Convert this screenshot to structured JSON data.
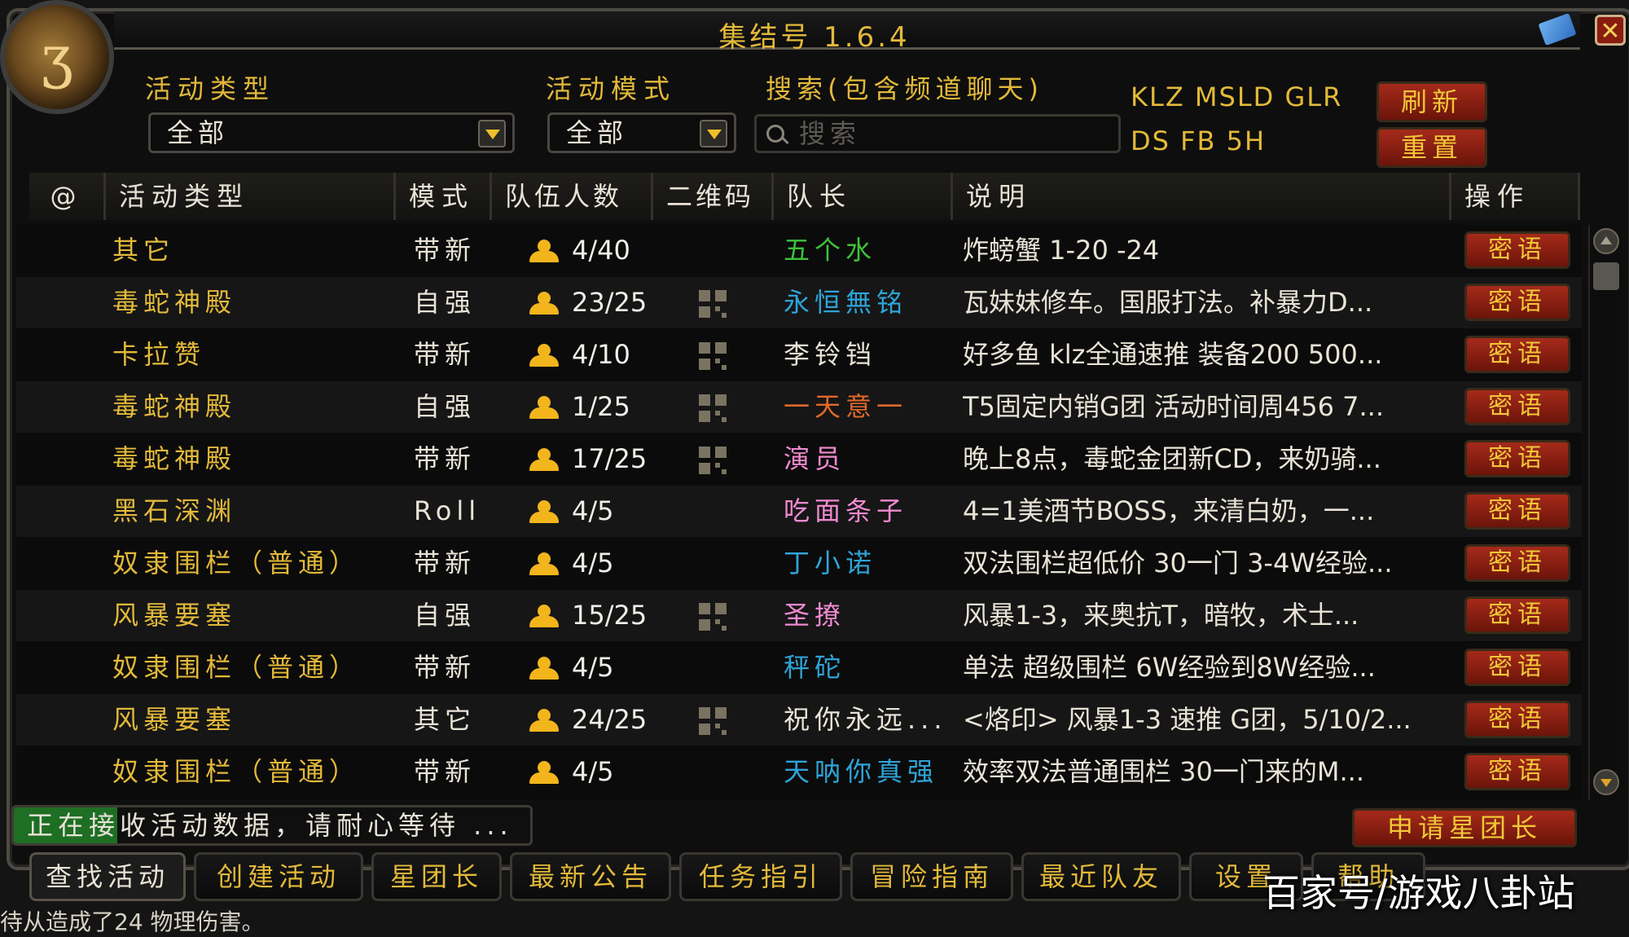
{
  "window": {
    "title": "集结号 1.6.4",
    "logo_glyph": "ʒ"
  },
  "filters": {
    "activity_type_label": "活动类型",
    "activity_type_value": "全部",
    "activity_mode_label": "活动模式",
    "activity_mode_value": "全部",
    "search_label": "搜索(包含频道聊天)",
    "search_placeholder": "搜索"
  },
  "tags": {
    "line1": "KLZ MSLD GLR",
    "line2": "DS FB 5H"
  },
  "buttons": {
    "refresh": "刷新",
    "reset": "重置",
    "whisper": "密语",
    "apply_leader": "申请星团长"
  },
  "columns": [
    "@",
    "活动类型",
    "模式",
    "队伍人数",
    "二维码",
    "队长",
    "说明",
    "操作"
  ],
  "rows": [
    {
      "type": "其它",
      "mode": "带新",
      "count": "4/40",
      "qr": false,
      "leader": "五个水",
      "leader_color": "#3fc23a",
      "desc": "炸螃蟹 1-20 -24"
    },
    {
      "type": "毒蛇神殿",
      "mode": "自强",
      "count": "23/25",
      "qr": true,
      "leader": "永恒無铭",
      "leader_color": "#2fa4d8",
      "desc": "瓦妹妹修车。国服打法。补暴力D..."
    },
    {
      "type": "卡拉赞",
      "mode": "带新",
      "count": "4/10",
      "qr": true,
      "leader": "李铃铛",
      "leader_color": "#e8e3d6",
      "desc": "好多鱼 klz全通速推 装备200 500..."
    },
    {
      "type": "毒蛇神殿",
      "mode": "自强",
      "count": "1/25",
      "qr": true,
      "leader": "一天意一",
      "leader_color": "#e0692a",
      "desc": "T5固定内销G团 活动时间周456 7..."
    },
    {
      "type": "毒蛇神殿",
      "mode": "带新",
      "count": "17/25",
      "qr": true,
      "leader": "演员",
      "leader_color": "#f08ad0",
      "desc": "晚上8点，毒蛇金团新CD，来奶骑..."
    },
    {
      "type": "黑石深渊",
      "mode": "Roll",
      "count": "4/5",
      "qr": false,
      "leader": "吃面条子",
      "leader_color": "#f08ad0",
      "desc": "4=1美酒节BOSS，来清白奶，一..."
    },
    {
      "type": "奴隶围栏（普通）",
      "mode": "带新",
      "count": "4/5",
      "qr": false,
      "leader": "丁小诺",
      "leader_color": "#2fa4d8",
      "desc": "双法围栏超低价 30一门 3-4W经验..."
    },
    {
      "type": "风暴要塞",
      "mode": "自强",
      "count": "15/25",
      "qr": true,
      "leader": "圣撩",
      "leader_color": "#f08ad0",
      "desc": "风暴1-3，来奥抗T，暗牧，术士..."
    },
    {
      "type": "奴隶围栏（普通）",
      "mode": "带新",
      "count": "4/5",
      "qr": false,
      "leader": "秤砣",
      "leader_color": "#2fa4d8",
      "desc": "单法 超级围栏 6W经验到8W经验..."
    },
    {
      "type": "风暴要塞",
      "mode": "其它",
      "count": "24/25",
      "qr": true,
      "leader": "祝你永远...",
      "leader_color": "#e8e3d6",
      "desc": "<烙印> 风暴1-3 速推 G团，5/10/2..."
    },
    {
      "type": "奴隶围栏（普通）",
      "mode": "带新",
      "count": "4/5",
      "qr": false,
      "leader": "天呐你真强",
      "leader_color": "#2fa4d8",
      "desc": "效率双法普通围栏 30一门来的M..."
    }
  ],
  "status": {
    "text": "正在接收活动数据，请耐心等待 ...",
    "progress": 0.2
  },
  "tabs": [
    "查找活动",
    "创建活动",
    "星团长",
    "最新公告",
    "任务指引",
    "冒险指南",
    "最近队友",
    "设置",
    "帮助"
  ],
  "combat_log": "待从造成了24 物理伤害。",
  "watermark": "百家号/游戏八卦站",
  "icons": {
    "mail": "mail-icon",
    "close": "close-icon",
    "member": "person-icon",
    "qr": "qr-icon",
    "search": "search-icon"
  }
}
